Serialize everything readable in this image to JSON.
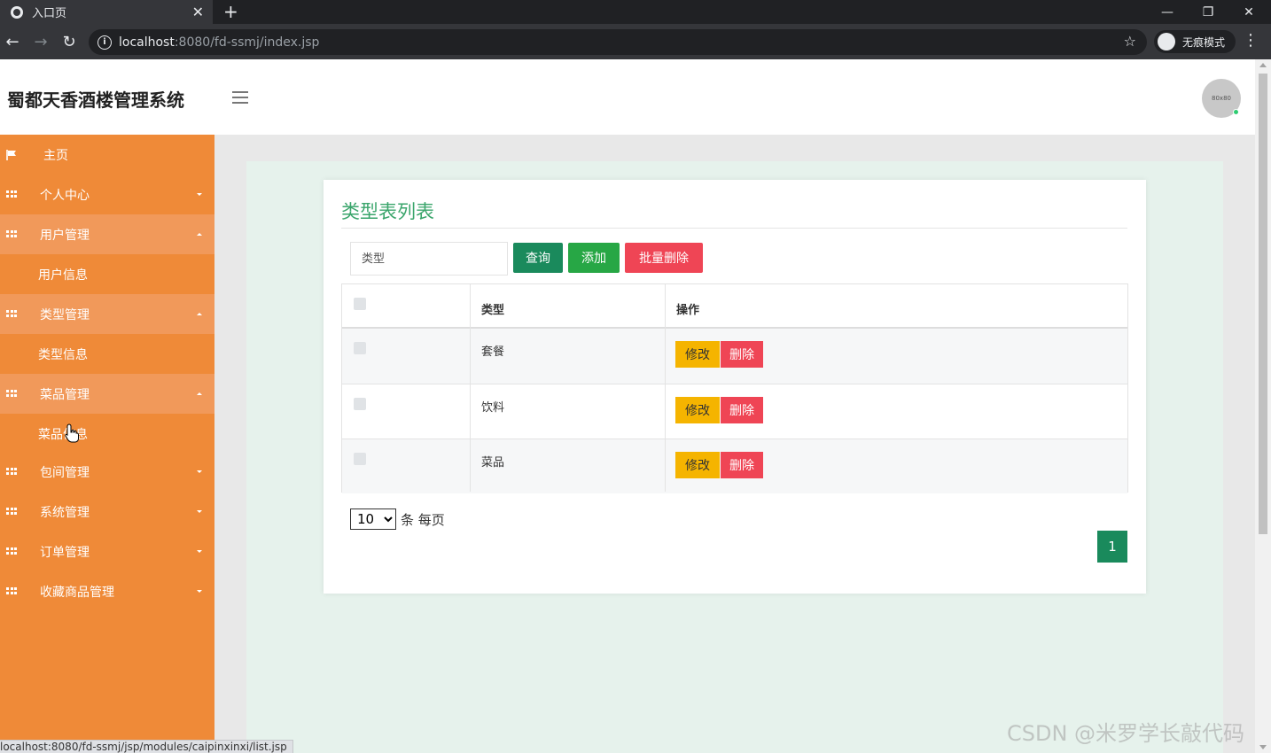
{
  "browser": {
    "tab_title": "入口页",
    "url_host": "localhost",
    "url_rest": ":8080/fd-ssmj/index.jsp",
    "incognito_label": "无痕模式",
    "status_url": "localhost:8080/fd-ssmj/jsp/modules/caipinxinxi/list.jsp"
  },
  "header": {
    "title": "蜀都天香酒楼管理系统",
    "avatar_text": "80x80"
  },
  "sidebar": {
    "items": [
      {
        "label": "主页"
      },
      {
        "label": "个人中心"
      },
      {
        "label": "用户管理"
      },
      {
        "label": "用户信息"
      },
      {
        "label": "类型管理"
      },
      {
        "label": "类型信息"
      },
      {
        "label": "菜品管理"
      },
      {
        "label": "菜品信息"
      },
      {
        "label": "包间管理"
      },
      {
        "label": "系统管理"
      },
      {
        "label": "订单管理"
      },
      {
        "label": "收藏商品管理"
      }
    ]
  },
  "main": {
    "title": "类型表列表",
    "search_placeholder": "类型",
    "query_label": "查询",
    "add_label": "添加",
    "bulk_delete_label": "批量删除",
    "columns": [
      "类型",
      "操作"
    ],
    "rows": [
      {
        "type": "套餐"
      },
      {
        "type": "饮料"
      },
      {
        "type": "菜品"
      }
    ],
    "edit_label": "修改",
    "delete_label": "删除",
    "page_size": "10",
    "per_page_label": "条 每页",
    "current_page": "1"
  },
  "watermark": "CSDN @米罗学长敲代码",
  "colors": {
    "sidebar": "#ef8a38",
    "primary_green": "#1a8a5c",
    "add_green": "#27a745",
    "danger": "#ef4555",
    "warning": "#f5b400",
    "title_green": "#3aa56b"
  }
}
